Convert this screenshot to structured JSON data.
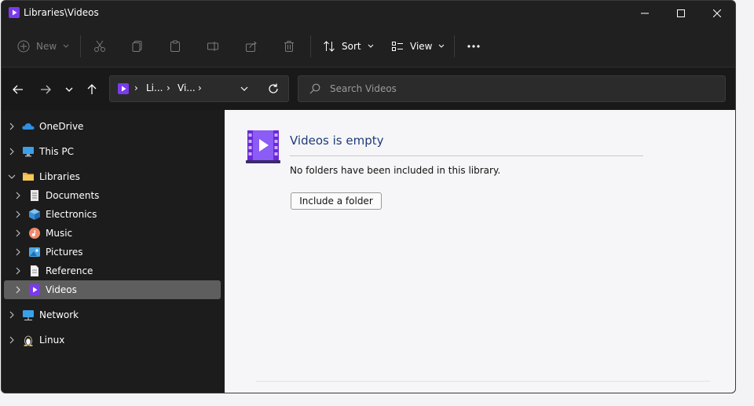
{
  "window": {
    "title": "Libraries\\Videos"
  },
  "toolbar": {
    "new_label": "New",
    "sort_label": "Sort",
    "view_label": "View"
  },
  "address": {
    "segments": [
      "Li...",
      "Vi..."
    ]
  },
  "search": {
    "placeholder": "Search Videos"
  },
  "sidebar": {
    "items": [
      {
        "label": "OneDrive",
        "icon": "onedrive-icon"
      },
      {
        "label": "This PC",
        "icon": "computer-icon"
      },
      {
        "label": "Libraries",
        "icon": "folder-icon"
      },
      {
        "label": "Documents",
        "icon": "documents-icon"
      },
      {
        "label": "Electronics",
        "icon": "cube-icon"
      },
      {
        "label": "Music",
        "icon": "music-icon"
      },
      {
        "label": "Pictures",
        "icon": "pictures-icon"
      },
      {
        "label": "Reference",
        "icon": "document-icon"
      },
      {
        "label": "Videos",
        "icon": "videos-icon",
        "selected": true
      },
      {
        "label": "Network",
        "icon": "network-icon"
      },
      {
        "label": "Linux",
        "icon": "linux-icon"
      }
    ]
  },
  "content": {
    "title": "Videos is empty",
    "description": "No folders have been included in this library.",
    "include_button": "Include a folder"
  },
  "colors": {
    "accent": "#7c3aed",
    "link_title": "#1f3a78"
  }
}
